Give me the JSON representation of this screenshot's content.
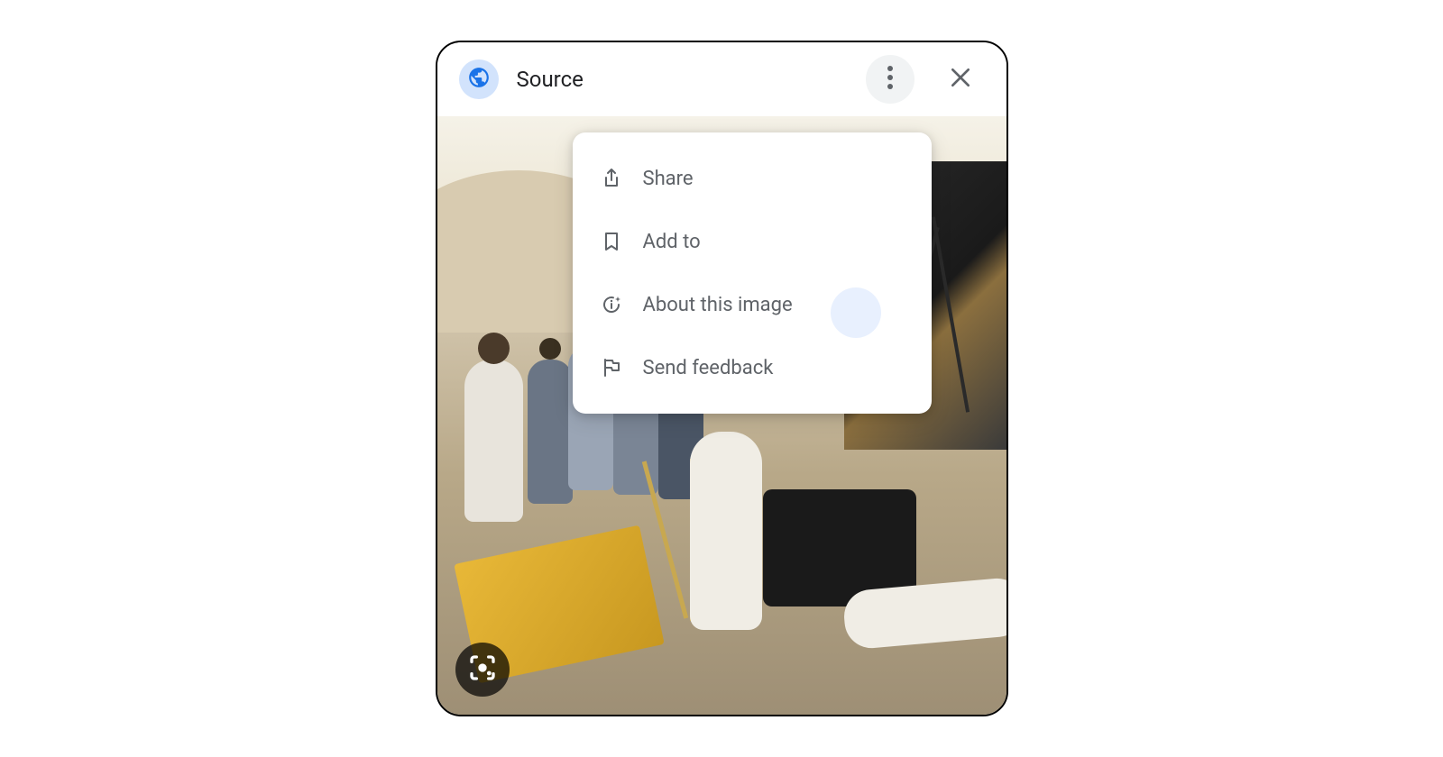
{
  "header": {
    "title": "Source"
  },
  "menu": {
    "items": [
      {
        "label": "Share",
        "icon": "share-icon"
      },
      {
        "label": "Add to",
        "icon": "bookmark-icon"
      },
      {
        "label": "About this image",
        "icon": "info-icon"
      },
      {
        "label": "Send feedback",
        "icon": "flag-icon"
      }
    ]
  }
}
